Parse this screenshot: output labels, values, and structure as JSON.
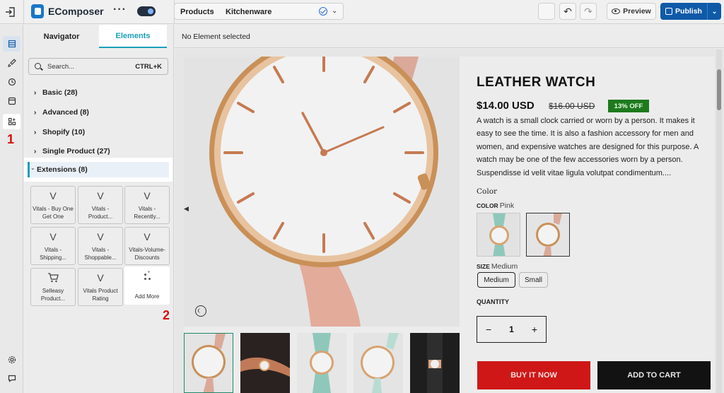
{
  "app": {
    "name": "EComposer",
    "menu_glyph": "···"
  },
  "breadcrumb": {
    "section": "Products",
    "page": "Kitchenware"
  },
  "toolbar": {
    "preview_label": "Preview",
    "publish_label": "Publish",
    "undo_glyph": "↶",
    "redo_glyph": "↷"
  },
  "rail": {
    "step1": "1",
    "step2": "2"
  },
  "sidebar": {
    "tabs": [
      {
        "label": "Navigator"
      },
      {
        "label": "Elements"
      }
    ],
    "search": {
      "placeholder": "Search...",
      "shortcut": "CTRL+K"
    },
    "categories": [
      {
        "label": "Basic (28)"
      },
      {
        "label": "Advanced (8)"
      },
      {
        "label": "Shopify (10)"
      },
      {
        "label": "Single Product (27)"
      }
    ],
    "extensions": {
      "label": "Extensions (8)",
      "items": [
        {
          "label": "Vitals - Buy One Get One",
          "icon": "vitals-icon"
        },
        {
          "label": "Vitals - Product...",
          "icon": "vitals-icon"
        },
        {
          "label": "Vitals - Recently...",
          "icon": "vitals-icon"
        },
        {
          "label": "Vitals - Shipping...",
          "icon": "vitals-icon"
        },
        {
          "label": "Vitals - Shoppable...",
          "icon": "vitals-icon"
        },
        {
          "label": "Vitals-Volume-Discounts",
          "icon": "vitals-icon"
        },
        {
          "label": "Selleasy Product...",
          "icon": "cart-icon"
        },
        {
          "label": "Vitals Product Rating",
          "icon": "vitals-icon"
        },
        {
          "label": "Add More",
          "icon": "add-apps-icon"
        }
      ]
    }
  },
  "status_text": "No Element selected",
  "product": {
    "title": "LEATHER WATCH",
    "price": "$14.00 USD",
    "compare_price": "$16.00 USD",
    "discount_badge": "13% OFF",
    "description": "A watch is a small clock carried or worn by a person. It makes it easy to see the time. It is also a fashion accessory for men and women, and expensive watches are designed for this purpose. A watch may be one of the few accessories worn by a person. Suspendisse id velit vitae ligula volutpat condimentum....",
    "color_heading": "Color",
    "color_label": "COLOR",
    "color_value": "Pink",
    "size_label": "SIZE",
    "size_value": "Medium",
    "sizes": [
      "Medium",
      "Small"
    ],
    "quantity_label": "QUANTITY",
    "quantity": "1",
    "buy_label": "BUY IT NOW",
    "cart_label": "ADD TO CART"
  },
  "colors": {
    "accent": "#1a9fb8",
    "publish": "#0f5aa8",
    "buy": "#cf1717",
    "badge": "#1e7a1e",
    "annotation": "#d80d0d"
  }
}
